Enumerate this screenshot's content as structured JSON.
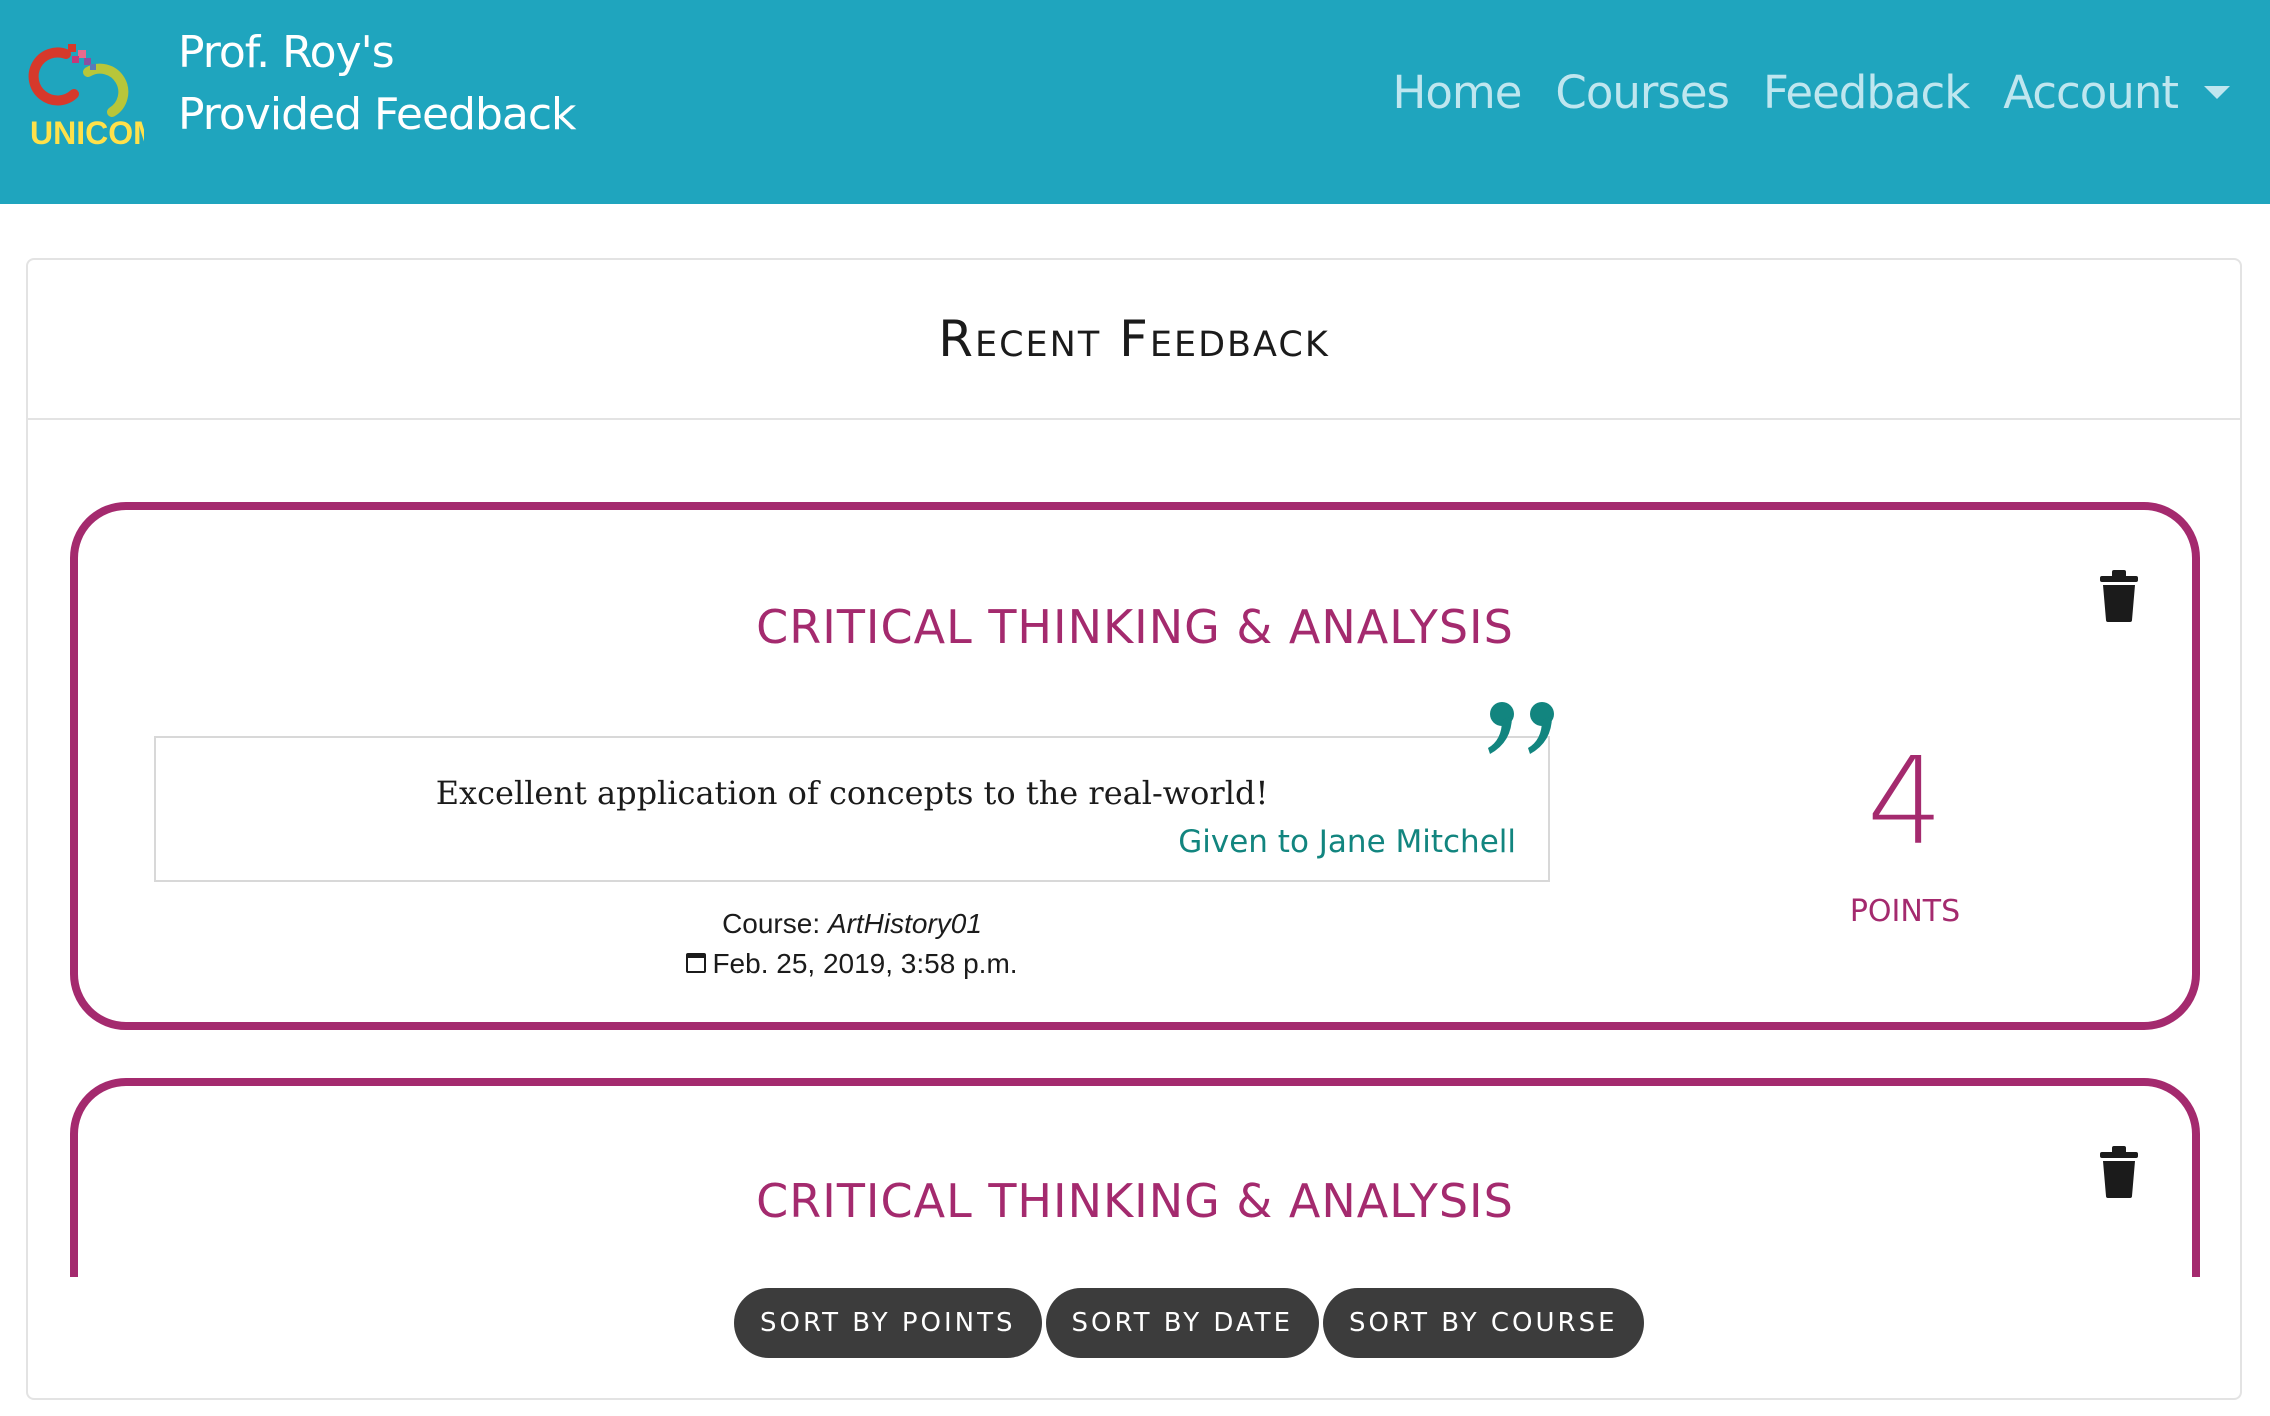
{
  "navbar": {
    "logo_text": "UNICOM",
    "brand_line1": "Prof. Roy's",
    "brand_line2": "Provided Feedback",
    "links": [
      "Home",
      "Courses",
      "Feedback",
      "Account"
    ]
  },
  "panel": {
    "title": "Recent Feedback"
  },
  "feedback": [
    {
      "category": "CRITICAL THINKING & ANALYSIS",
      "quote": "Excellent application of concepts to the real-world!",
      "given_to": "Given to Jane Mitchell",
      "course_label": "Course:",
      "course": "ArtHistory01",
      "date": "Feb. 25, 2019, 3:58 p.m.",
      "points": "4",
      "points_label": "POINTS"
    },
    {
      "category": "CRITICAL THINKING & ANALYSIS"
    }
  ],
  "sort": {
    "by_points": "SORT BY POINTS",
    "by_date": "SORT BY DATE",
    "by_course": "SORT BY COURSE"
  },
  "colors": {
    "navbar": "#1fa5be",
    "accent": "#a42a6e",
    "teal": "#12857f",
    "button": "#3c3c3c"
  }
}
